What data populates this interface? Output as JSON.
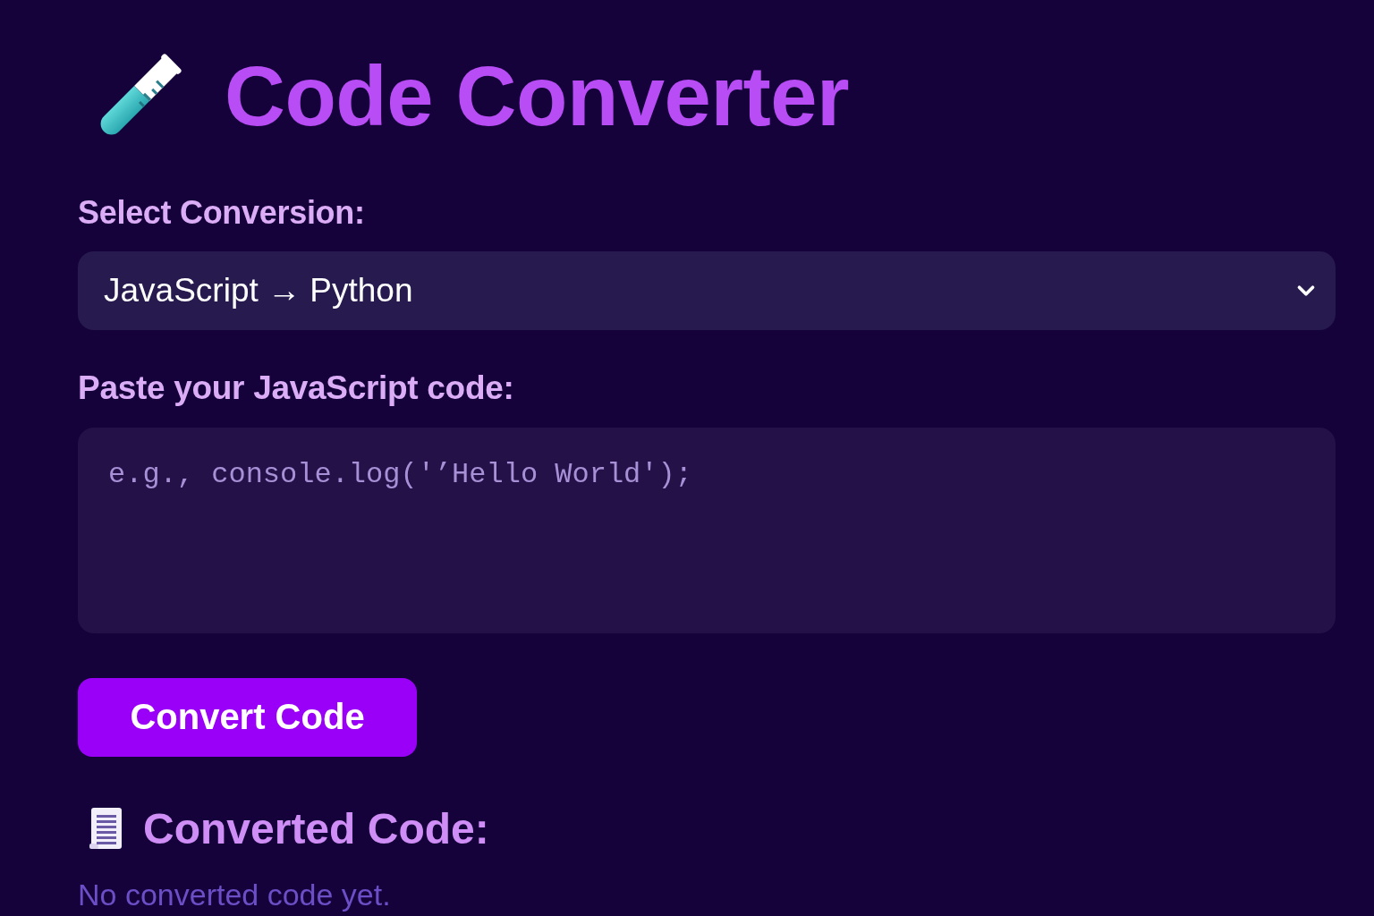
{
  "header": {
    "title": "Code Converter"
  },
  "conversion": {
    "label": "Select Conversion:",
    "value": "JavaScript → Python"
  },
  "code_input": {
    "label": "Paste your JavaScript code:",
    "placeholder": "e.g., console.log('’Hello World');"
  },
  "convert_button": {
    "label": "Convert Code"
  },
  "output": {
    "heading": "Converted Code:",
    "empty_text": "No converted code yet."
  }
}
